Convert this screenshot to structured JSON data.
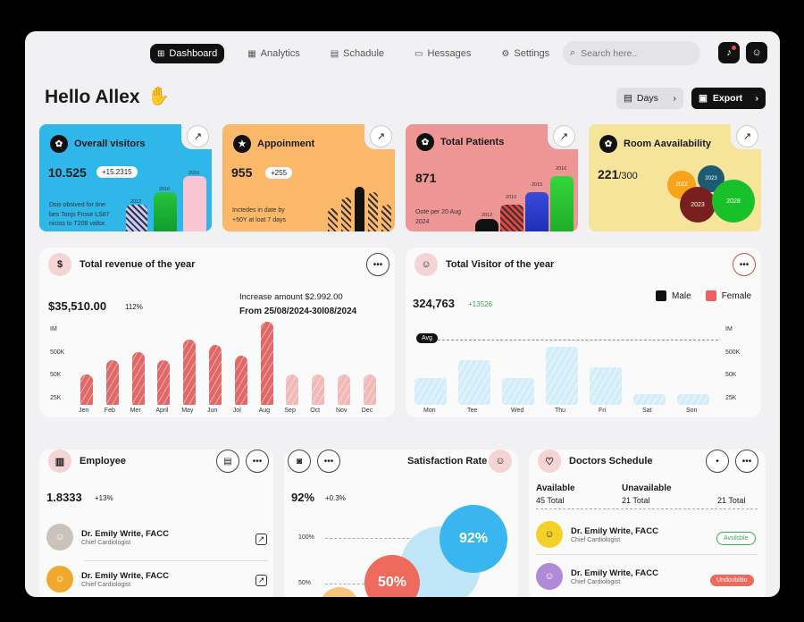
{
  "nav": {
    "dashboard": "Dashboard",
    "analytics": "Analytics",
    "schedule": "Schadule",
    "messages": "Hessages",
    "settings": "Settings"
  },
  "search": {
    "placeholder": "Search here.."
  },
  "header": {
    "greeting": "Hello Allex",
    "days_label": "Days",
    "export_label": "Export"
  },
  "colors": {
    "accent": "#e06868",
    "blue": "#2fb7ea",
    "orange": "#fbb86a",
    "pink": "#ee9696",
    "yellow": "#f7e49b"
  },
  "cards": {
    "visitors": {
      "title": "Overall visitors",
      "value": "10.525",
      "badge": "+15.2315",
      "note1": "Dsis obsived for tine",
      "note2": "bes Tonjs Frose LS87",
      "note3": "nicios to T208 valtor.",
      "bar_labels": [
        "2012",
        "2016",
        "2016"
      ]
    },
    "appointment": {
      "title": "Appoinment",
      "value": "955",
      "badge": "+255",
      "note1": "Inctedes in date by",
      "note2": "+50Y at loat 7 days"
    },
    "patients": {
      "title": "Total Patients",
      "value": "871",
      "note1": "Oote per 20 Aug",
      "note2": "2024",
      "bar_labels": [
        "2012",
        "2010",
        "2015",
        "2016"
      ]
    },
    "rooms": {
      "title": "Room Aavailability",
      "value": "221",
      "total": "/300",
      "bubbles": [
        "2022",
        "2023",
        "2023",
        "2028"
      ]
    }
  },
  "revenue": {
    "title": "Total revenue of the year",
    "value": "$35,510.00",
    "pct": "112%",
    "increase": "Increase amount $2.992.00",
    "range": "From 25/08/2024-30l08/2024",
    "y_labels": [
      "IM",
      "500K",
      "50K",
      "25K"
    ]
  },
  "visitors_year": {
    "title": "Total  Visitor of the year",
    "value": "324,763",
    "change": "+13526",
    "legend_male": "Male",
    "legend_female": "Female",
    "avg_label": "Avg",
    "y_labels": [
      "IM",
      "500K",
      "50K",
      "25K"
    ]
  },
  "chart_data": [
    {
      "type": "bar",
      "title": "Total revenue of the year",
      "categories": [
        "Jen",
        "Feb",
        "Mer",
        "April",
        "May",
        "Jun",
        "Jol",
        "Aug",
        "Sep",
        "Oct",
        "Nov",
        "Dec"
      ],
      "values": [
        3,
        4.5,
        5.3,
        4.5,
        6.5,
        6,
        4.9,
        8.3,
        3,
        3,
        3,
        3
      ],
      "ylim": [
        0,
        10
      ]
    },
    {
      "type": "bar",
      "title": "Total  Visitor of the year",
      "categories": [
        "Mon",
        "Tee",
        "Wed",
        "Thu",
        "Fri",
        "Sat",
        "Son"
      ],
      "values": [
        3,
        5,
        3,
        6.5,
        4.2,
        1.2,
        1.2
      ],
      "ylim": [
        0,
        10
      ]
    }
  ],
  "employee": {
    "title": "Employee",
    "value": "1.8333",
    "change": "+13%",
    "people": [
      {
        "name": "Dr. Emily Write, FACC",
        "role": "Chief Cardiologist"
      },
      {
        "name": "Dr. Emily Write, FACC",
        "role": "Chief Cardiologist"
      }
    ]
  },
  "satisfaction": {
    "title": "Satisfaction Rate",
    "value": "92%",
    "change": "+0.3%",
    "y100": "100%",
    "y50": "50%",
    "bubble_high": "92%",
    "bubble_low": "50%"
  },
  "doctors": {
    "title": "Doctors Schedule",
    "available_label": "Available",
    "available_total": "45 Total",
    "unavailable_label": "Unavailable",
    "unavailable_total": "21 Total",
    "third_total": "21 Total",
    "people": [
      {
        "name": "Dr. Emily Write, FACC",
        "role": "Chief Cardiologist",
        "status": "Avsilsble"
      },
      {
        "name": "Dr. Emily Write, FACC",
        "role": "Chief Cardiologist",
        "status": "Undovbiltio"
      }
    ]
  }
}
